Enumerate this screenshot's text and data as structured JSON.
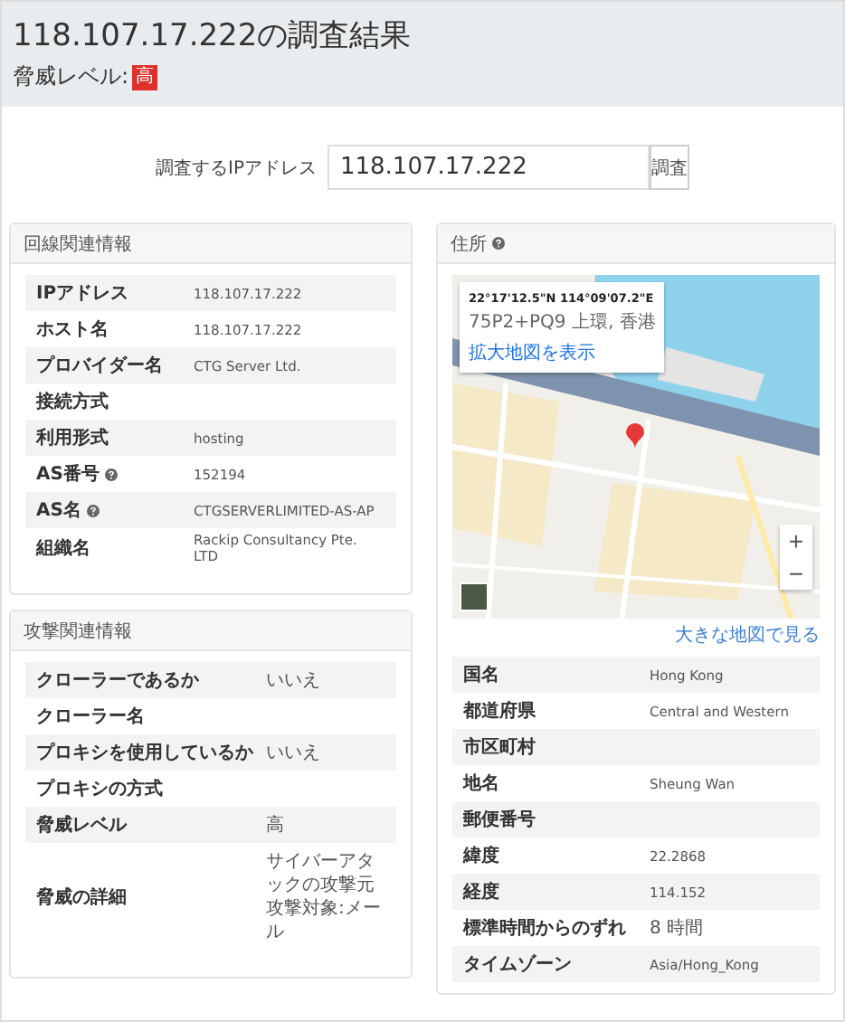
{
  "header": {
    "title": "118.107.17.222の調査結果",
    "threat_label": "脅威レベル:",
    "threat_badge": "高"
  },
  "search": {
    "label": "調査するIPアドレス",
    "value": "118.107.17.222",
    "button": "調査"
  },
  "network": {
    "title": "回線関連情報",
    "rows": [
      {
        "label": "IPアドレス",
        "value": "118.107.17.222"
      },
      {
        "label": "ホスト名",
        "value": "118.107.17.222"
      },
      {
        "label": "プロバイダー名",
        "value": "CTG Server Ltd."
      },
      {
        "label": "接続方式"
      },
      {
        "label": "利用形式",
        "value": "hosting"
      },
      {
        "label": "AS番号",
        "value": "152194",
        "help": true
      },
      {
        "label": "AS名",
        "value": "CTGSERVERLIMITED-AS-AP",
        "help": true
      },
      {
        "label": "組織名",
        "value": "Rackip Consultancy Pte. LTD"
      }
    ]
  },
  "attack": {
    "title": "攻撃関連情報",
    "rows": [
      {
        "label": "クローラーであるか",
        "value": "いいえ"
      },
      {
        "label": "クローラー名"
      },
      {
        "label": "プロキシを使用しているか",
        "value": "いいえ"
      },
      {
        "label": "プロキシの方式"
      },
      {
        "label": "脅威レベル",
        "value": "高"
      },
      {
        "label": "脅威の詳細",
        "lines": [
          "サイバーアタックの攻撃元",
          "攻撃対象:メール"
        ]
      }
    ]
  },
  "location": {
    "title": "住所",
    "help": true,
    "map": {
      "coords": "22°17'12.5\"N 114°09'07.2\"E",
      "plus_code": "75P2+PQ9 上環, 香港",
      "enlarge_link": "拡大地図を表示",
      "zoom_in": "+",
      "zoom_out": "−"
    },
    "large_map_link": "大きな地図で見る",
    "rows": [
      {
        "label": "国名",
        "value": "Hong Kong"
      },
      {
        "label": "都道府県",
        "value": "Central and Western"
      },
      {
        "label": "市区町村"
      },
      {
        "label": "地名",
        "value": "Sheung Wan"
      },
      {
        "label": "郵便番号"
      },
      {
        "label": "緯度",
        "value": "22.2868"
      },
      {
        "label": "経度",
        "value": "114.152"
      },
      {
        "label": "標準時間からのずれ",
        "value": "8 時間"
      },
      {
        "label": "タイムゾーン",
        "value": "Asia/Hong_Kong"
      }
    ]
  }
}
